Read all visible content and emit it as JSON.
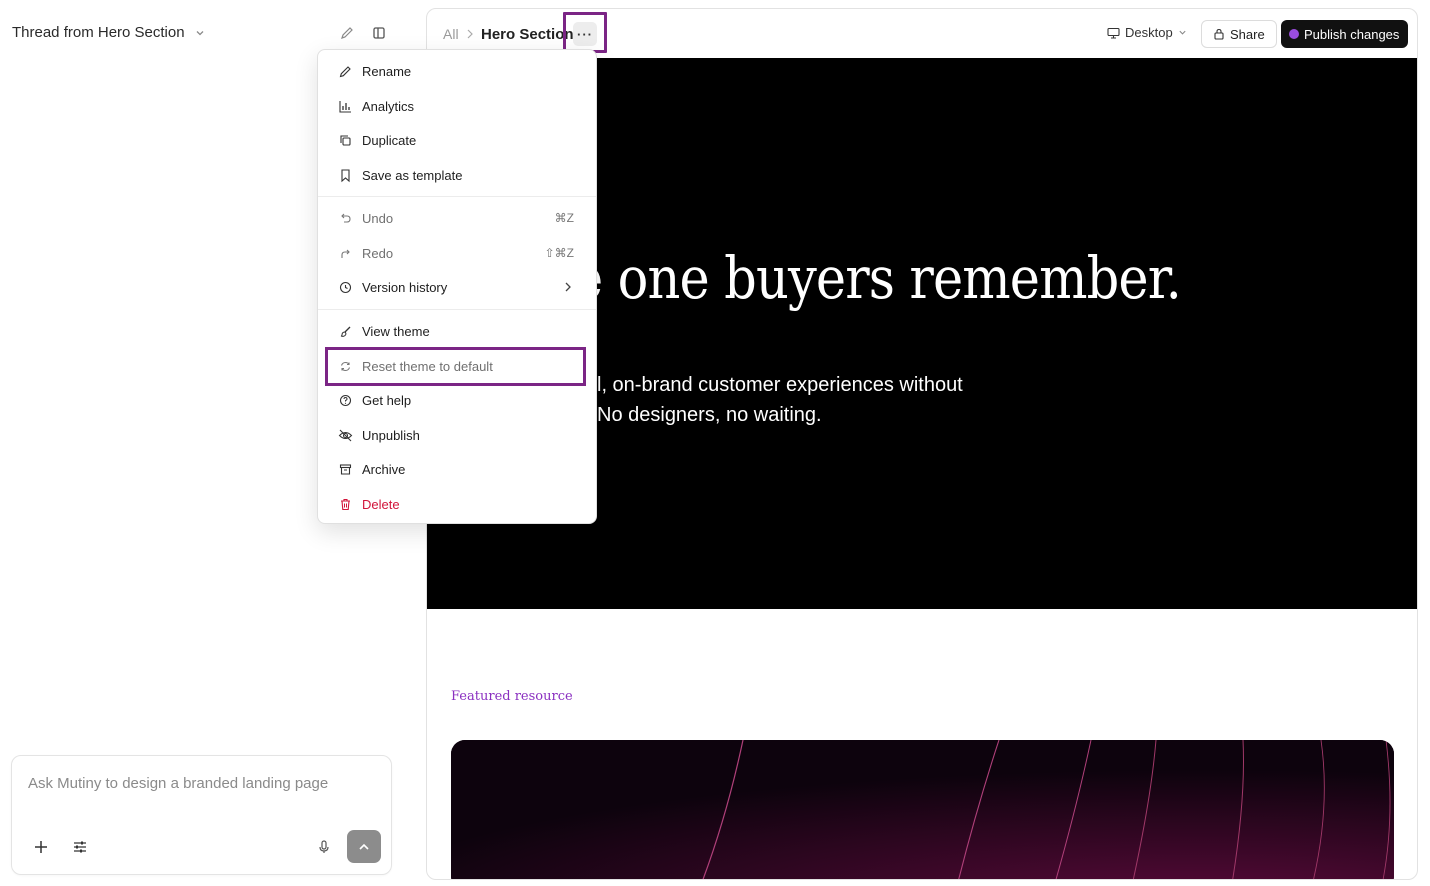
{
  "thread": {
    "title": "Thread from Hero Section"
  },
  "composer": {
    "placeholder": "Ask Mutiny to design a branded landing page"
  },
  "breadcrumb": {
    "root": "All",
    "current": "Hero Section",
    "more": "···"
  },
  "toolbar": {
    "device": "Desktop",
    "share": "Share",
    "publish": "Publish changes",
    "publish_dot_color": "#9b4dde"
  },
  "hero": {
    "title": "e one buyers remember.",
    "subtitle_line1": "l, on-brand customer experiences without",
    "subtitle_line2": "No designers, no waiting."
  },
  "featured": {
    "label": "Featured resource"
  },
  "menu": {
    "items": [
      {
        "label": "Rename",
        "icon": "pencil-icon"
      },
      {
        "label": "Analytics",
        "icon": "bar-chart-icon"
      },
      {
        "label": "Duplicate",
        "icon": "copy-icon"
      },
      {
        "label": "Save as template",
        "icon": "bookmark-icon"
      },
      {
        "label": "Undo",
        "icon": "undo-icon",
        "shortcut": "⌘Z"
      },
      {
        "label": "Redo",
        "icon": "redo-icon",
        "shortcut": "⇧⌘Z"
      },
      {
        "label": "Version history",
        "icon": "clock-icon"
      },
      {
        "label": "View theme",
        "icon": "paintbrush-icon"
      },
      {
        "label": "Reset theme to default",
        "icon": "refresh-icon"
      },
      {
        "label": "Get help",
        "icon": "help-circle-icon"
      },
      {
        "label": "Unpublish",
        "icon": "eye-off-icon"
      },
      {
        "label": "Archive",
        "icon": "archive-icon"
      },
      {
        "label": "Delete",
        "icon": "trash-icon"
      }
    ]
  },
  "colors": {
    "accent": "#7b2585",
    "delete": "#d2143a",
    "featured": "#8a2fc0"
  }
}
